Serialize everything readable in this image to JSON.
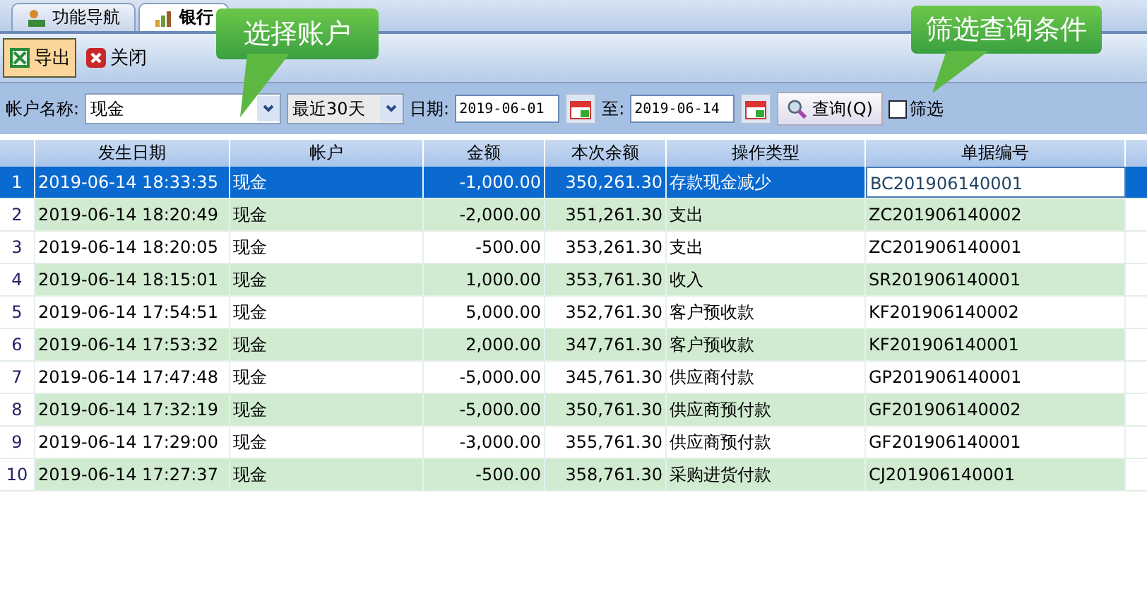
{
  "tabs": [
    {
      "label": "功能导航",
      "selected": false
    },
    {
      "label": "银行",
      "selected": true
    }
  ],
  "toolbar": [
    {
      "label": "导出",
      "kind": "export",
      "selected": true
    },
    {
      "label": "关闭",
      "kind": "close",
      "selected": false
    }
  ],
  "filters": {
    "account_label": "帐户名称:",
    "account_value": "现金",
    "period_value": "最近30天",
    "date_label": "日期:",
    "date_from": "2019-06-01",
    "to_label": "至:",
    "date_to": "2019-06-14",
    "query_button": "查询(Q)",
    "filter_checkbox": {
      "label": "筛选",
      "checked": false
    }
  },
  "table": {
    "columns": [
      "发生日期",
      "帐户",
      "金额",
      "本次余额",
      "操作类型",
      "单据编号"
    ],
    "rows": [
      {
        "index": "1",
        "cells": [
          "2019-06-14 18:33:35",
          "现金",
          "-1,000.00",
          "350,261.30",
          "存款现金减少",
          "BC201906140001"
        ],
        "selected": true
      },
      {
        "index": "2",
        "cells": [
          "2019-06-14 18:20:49",
          "现金",
          "-2,000.00",
          "351,261.30",
          "支出",
          "ZC201906140002"
        ],
        "selected": false
      },
      {
        "index": "3",
        "cells": [
          "2019-06-14 18:20:05",
          "现金",
          "-500.00",
          "353,261.30",
          "支出",
          "ZC201906140001"
        ],
        "selected": false
      },
      {
        "index": "4",
        "cells": [
          "2019-06-14 18:15:01",
          "现金",
          "1,000.00",
          "353,761.30",
          "收入",
          "SR201906140001"
        ],
        "selected": false
      },
      {
        "index": "5",
        "cells": [
          "2019-06-14 17:54:51",
          "现金",
          "5,000.00",
          "352,761.30",
          "客户预收款",
          "KF201906140002"
        ],
        "selected": false
      },
      {
        "index": "6",
        "cells": [
          "2019-06-14 17:53:32",
          "现金",
          "2,000.00",
          "347,761.30",
          "客户预收款",
          "KF201906140001"
        ],
        "selected": false
      },
      {
        "index": "7",
        "cells": [
          "2019-06-14 17:47:48",
          "现金",
          "-5,000.00",
          "345,761.30",
          "供应商付款",
          "GP201906140001"
        ],
        "selected": false
      },
      {
        "index": "8",
        "cells": [
          "2019-06-14 17:32:19",
          "现金",
          "-5,000.00",
          "350,761.30",
          "供应商预付款",
          "GF201906140002"
        ],
        "selected": false
      },
      {
        "index": "9",
        "cells": [
          "2019-06-14 17:29:00",
          "现金",
          "-3,000.00",
          "355,761.30",
          "供应商预付款",
          "GF201906140001"
        ],
        "selected": false
      },
      {
        "index": "10",
        "cells": [
          "2019-06-14 17:27:37",
          "现金",
          "-500.00",
          "358,761.30",
          "采购进货付款",
          "CJ201906140001"
        ],
        "selected": false
      }
    ]
  },
  "callouts": [
    {
      "text": "选择账户"
    },
    {
      "text": "筛选查询条件"
    }
  ]
}
